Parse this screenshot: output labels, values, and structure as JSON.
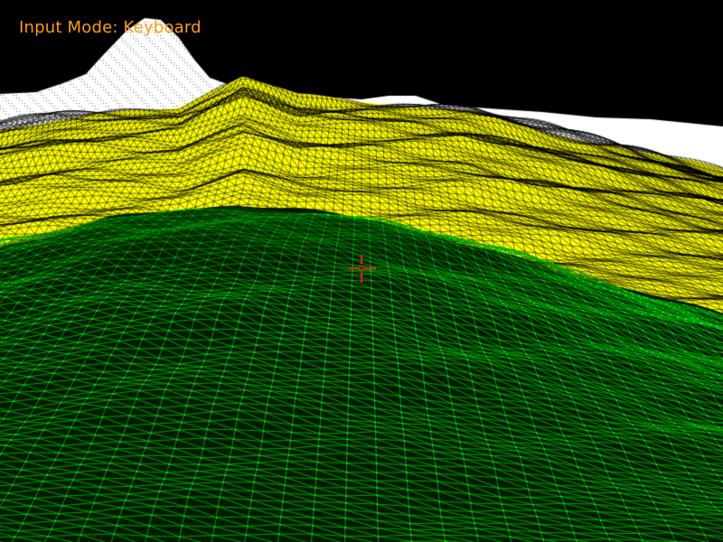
{
  "hud": {
    "input_mode_text": "Input Mode: Keyboard"
  },
  "colors": {
    "sky": "#000000",
    "snow": "#ffffff",
    "highland": "#ffff00",
    "lowland": "#00a000",
    "lowland_vertex": "#20ff40",
    "hud_text": "#ff9a1a",
    "crosshair": "#ff2020"
  },
  "icons": {
    "reticle": "crosshair-icon"
  }
}
